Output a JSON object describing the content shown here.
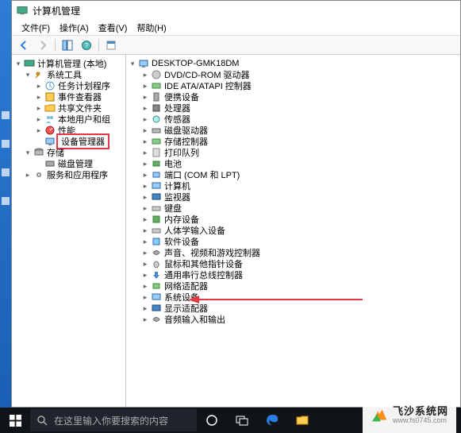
{
  "window": {
    "title": "计算机管理",
    "menu": {
      "file": "文件(F)",
      "action": "操作(A)",
      "view": "查看(V)",
      "help": "帮助(H)"
    }
  },
  "left_tree": {
    "root": "计算机管理 (本地)",
    "system_tools": "系统工具",
    "task_scheduler": "任务计划程序",
    "event_viewer": "事件查看器",
    "shared_folders": "共享文件夹",
    "local_users": "本地用户和组",
    "performance": "性能",
    "device_manager": "设备管理器",
    "storage": "存储",
    "disk_mgmt": "磁盘管理",
    "services_apps": "服务和应用程序"
  },
  "right_tree": {
    "root": "DESKTOP-GMK18DM",
    "items": [
      "DVD/CD-ROM 驱动器",
      "IDE ATA/ATAPI 控制器",
      "便携设备",
      "处理器",
      "传感器",
      "磁盘驱动器",
      "存储控制器",
      "打印队列",
      "电池",
      "端口 (COM 和 LPT)",
      "计算机",
      "监视器",
      "键盘",
      "内存设备",
      "人体学输入设备",
      "软件设备",
      "声音、视频和游戏控制器",
      "鼠标和其他指针设备",
      "通用串行总线控制器",
      "网络适配器",
      "系统设备",
      "显示适配器",
      "音频输入和输出"
    ]
  },
  "taskbar": {
    "search_placeholder": "在这里输入你要搜索的内容"
  },
  "watermark": {
    "name": "飞沙系统网",
    "url": "www.fs0745.com"
  },
  "colors": {
    "highlight": "#e63946",
    "taskbar": "#101318",
    "desktop": "#1a5fb4"
  }
}
